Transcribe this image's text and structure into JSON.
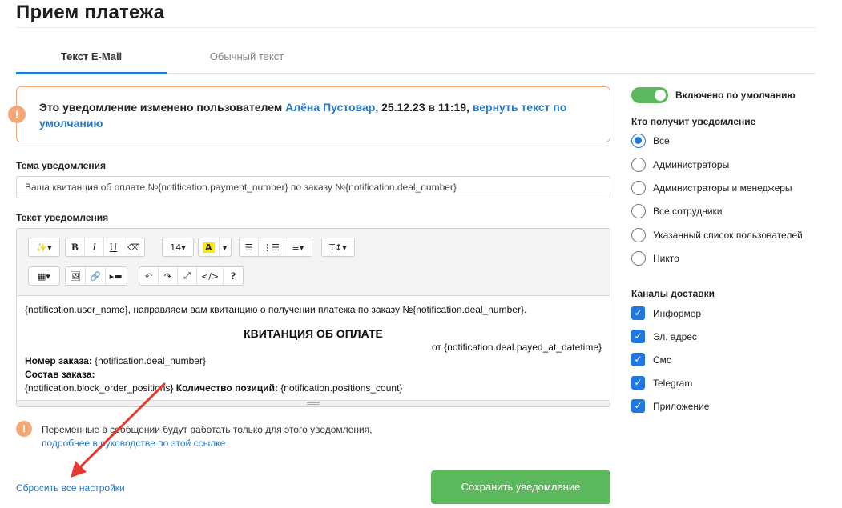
{
  "page": {
    "title": "Прием платежа"
  },
  "tabs": [
    {
      "label": "Текст E-Mail",
      "active": true
    },
    {
      "label": "Обычный текст",
      "active": false
    }
  ],
  "warning": {
    "icon": "exclamation-icon",
    "prefix": "Это уведомление изменено пользователем ",
    "user": "Алёна Пустовар",
    "middle": ", 25.12.23 в 11:19, ",
    "revert_link": "вернуть текст по умолчанию"
  },
  "subject": {
    "label": "Тема уведомления",
    "value": "Ваша квитанция об оплате №{notification.payment_number} по заказу №{notification.deal_number}"
  },
  "body": {
    "label": "Текст уведомления",
    "toolbar": {
      "row1": [
        "✨▾",
        "B",
        "I",
        "U",
        "⌫",
        "14▾",
        "A",
        "▾",
        "☰",
        "⋮☰",
        "≡▾",
        "T↕▾"
      ],
      "row2": [
        "▦▾",
        "🖼",
        "🔗",
        "▸▬",
        "↶",
        "↷",
        "⤢",
        "</>",
        "?"
      ]
    },
    "content": {
      "line1": "{notification.user_name}, направляем вам квитанцию о получении платежа по заказу №{notification.deal_number}.",
      "heading": "КВИТАНЦИЯ ОБ ОПЛАТЕ",
      "date_line": "от {notification.deal.payed_at_datetime}",
      "order_label": "Номер заказа:",
      "order_value": " {notification.deal_number}",
      "composition_label": "Состав заказа:",
      "positions_prefix": "{notification.block_order_positions} ",
      "positions_label": "Количество позиций:",
      "positions_value": " {notification.positions_count}"
    }
  },
  "note": {
    "icon": "exclamation-icon",
    "text": "Переменные в сообщении будут работать только для этого уведомления,",
    "link": "подробнее в руководстве по этой ссылке"
  },
  "actions": {
    "reset_label": "Сбросить все настройки",
    "save_label": "Сохранить уведомление"
  },
  "sidebar": {
    "toggle_label": "Включено по умолчанию",
    "toggle_on": true,
    "recipients_title": "Кто получит уведомление",
    "recipients": [
      {
        "label": "Все",
        "selected": true
      },
      {
        "label": "Администраторы",
        "selected": false
      },
      {
        "label": "Администраторы и менеджеры",
        "selected": false
      },
      {
        "label": "Все сотрудники",
        "selected": false
      },
      {
        "label": "Указанный список пользователей",
        "selected": false
      },
      {
        "label": "Никто",
        "selected": false
      }
    ],
    "channels_title": "Каналы доставки",
    "channels": [
      {
        "label": "Информер",
        "checked": true
      },
      {
        "label": "Эл. адрес",
        "checked": true
      },
      {
        "label": "Смс",
        "checked": true
      },
      {
        "label": "Telegram",
        "checked": true
      },
      {
        "label": "Приложение",
        "checked": true
      }
    ]
  },
  "colors": {
    "accent": "#1f77e0",
    "success": "#5cb85c",
    "warning_border": "#f3a878",
    "link": "#2a78c4",
    "annotation_arrow": "#e53a2f"
  }
}
